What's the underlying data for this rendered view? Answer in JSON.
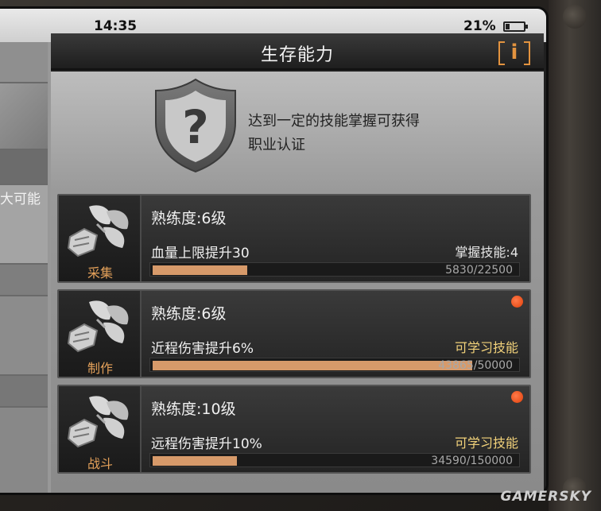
{
  "status_bar": {
    "time": "14:35",
    "battery": "21%",
    "battery_level": 0.21
  },
  "left_panel": {
    "partial_label": "大可能"
  },
  "title": "生存能力",
  "info_button": "i",
  "header": {
    "icon": "shield-question-icon",
    "text_line1": "达到一定的技能掌握可获得",
    "text_line2": "职业认证"
  },
  "cards": [
    {
      "category": "采集",
      "level": "熟练度:6级",
      "bonus": "血量上限提升30",
      "right_label": "掌握技能:4",
      "right_type": "mastered",
      "progress_text": "5830/22500",
      "progress": 0.259,
      "has_notification": false,
      "icon": "fist-leaves-icon"
    },
    {
      "category": "制作",
      "level": "熟练度:6级",
      "bonus": "近程伤害提升6%",
      "right_label": "可学习技能",
      "right_type": "learnable",
      "progress_text": "43865/50000",
      "progress": 0.877,
      "has_notification": true,
      "icon": "fist-leaves-icon"
    },
    {
      "category": "战斗",
      "level": "熟练度:10级",
      "bonus": "远程伤害提升10%",
      "right_label": "可学习技能",
      "right_type": "learnable",
      "progress_text": "34590/150000",
      "progress": 0.231,
      "has_notification": true,
      "icon": "fist-leaves-icon"
    }
  ],
  "watermark": "GAMERSKY",
  "colors": {
    "accent_orange": "#e3933f",
    "progress_fill": "#d79a6a",
    "notification": "#e0400a",
    "learnable_text": "#f2d27a"
  }
}
